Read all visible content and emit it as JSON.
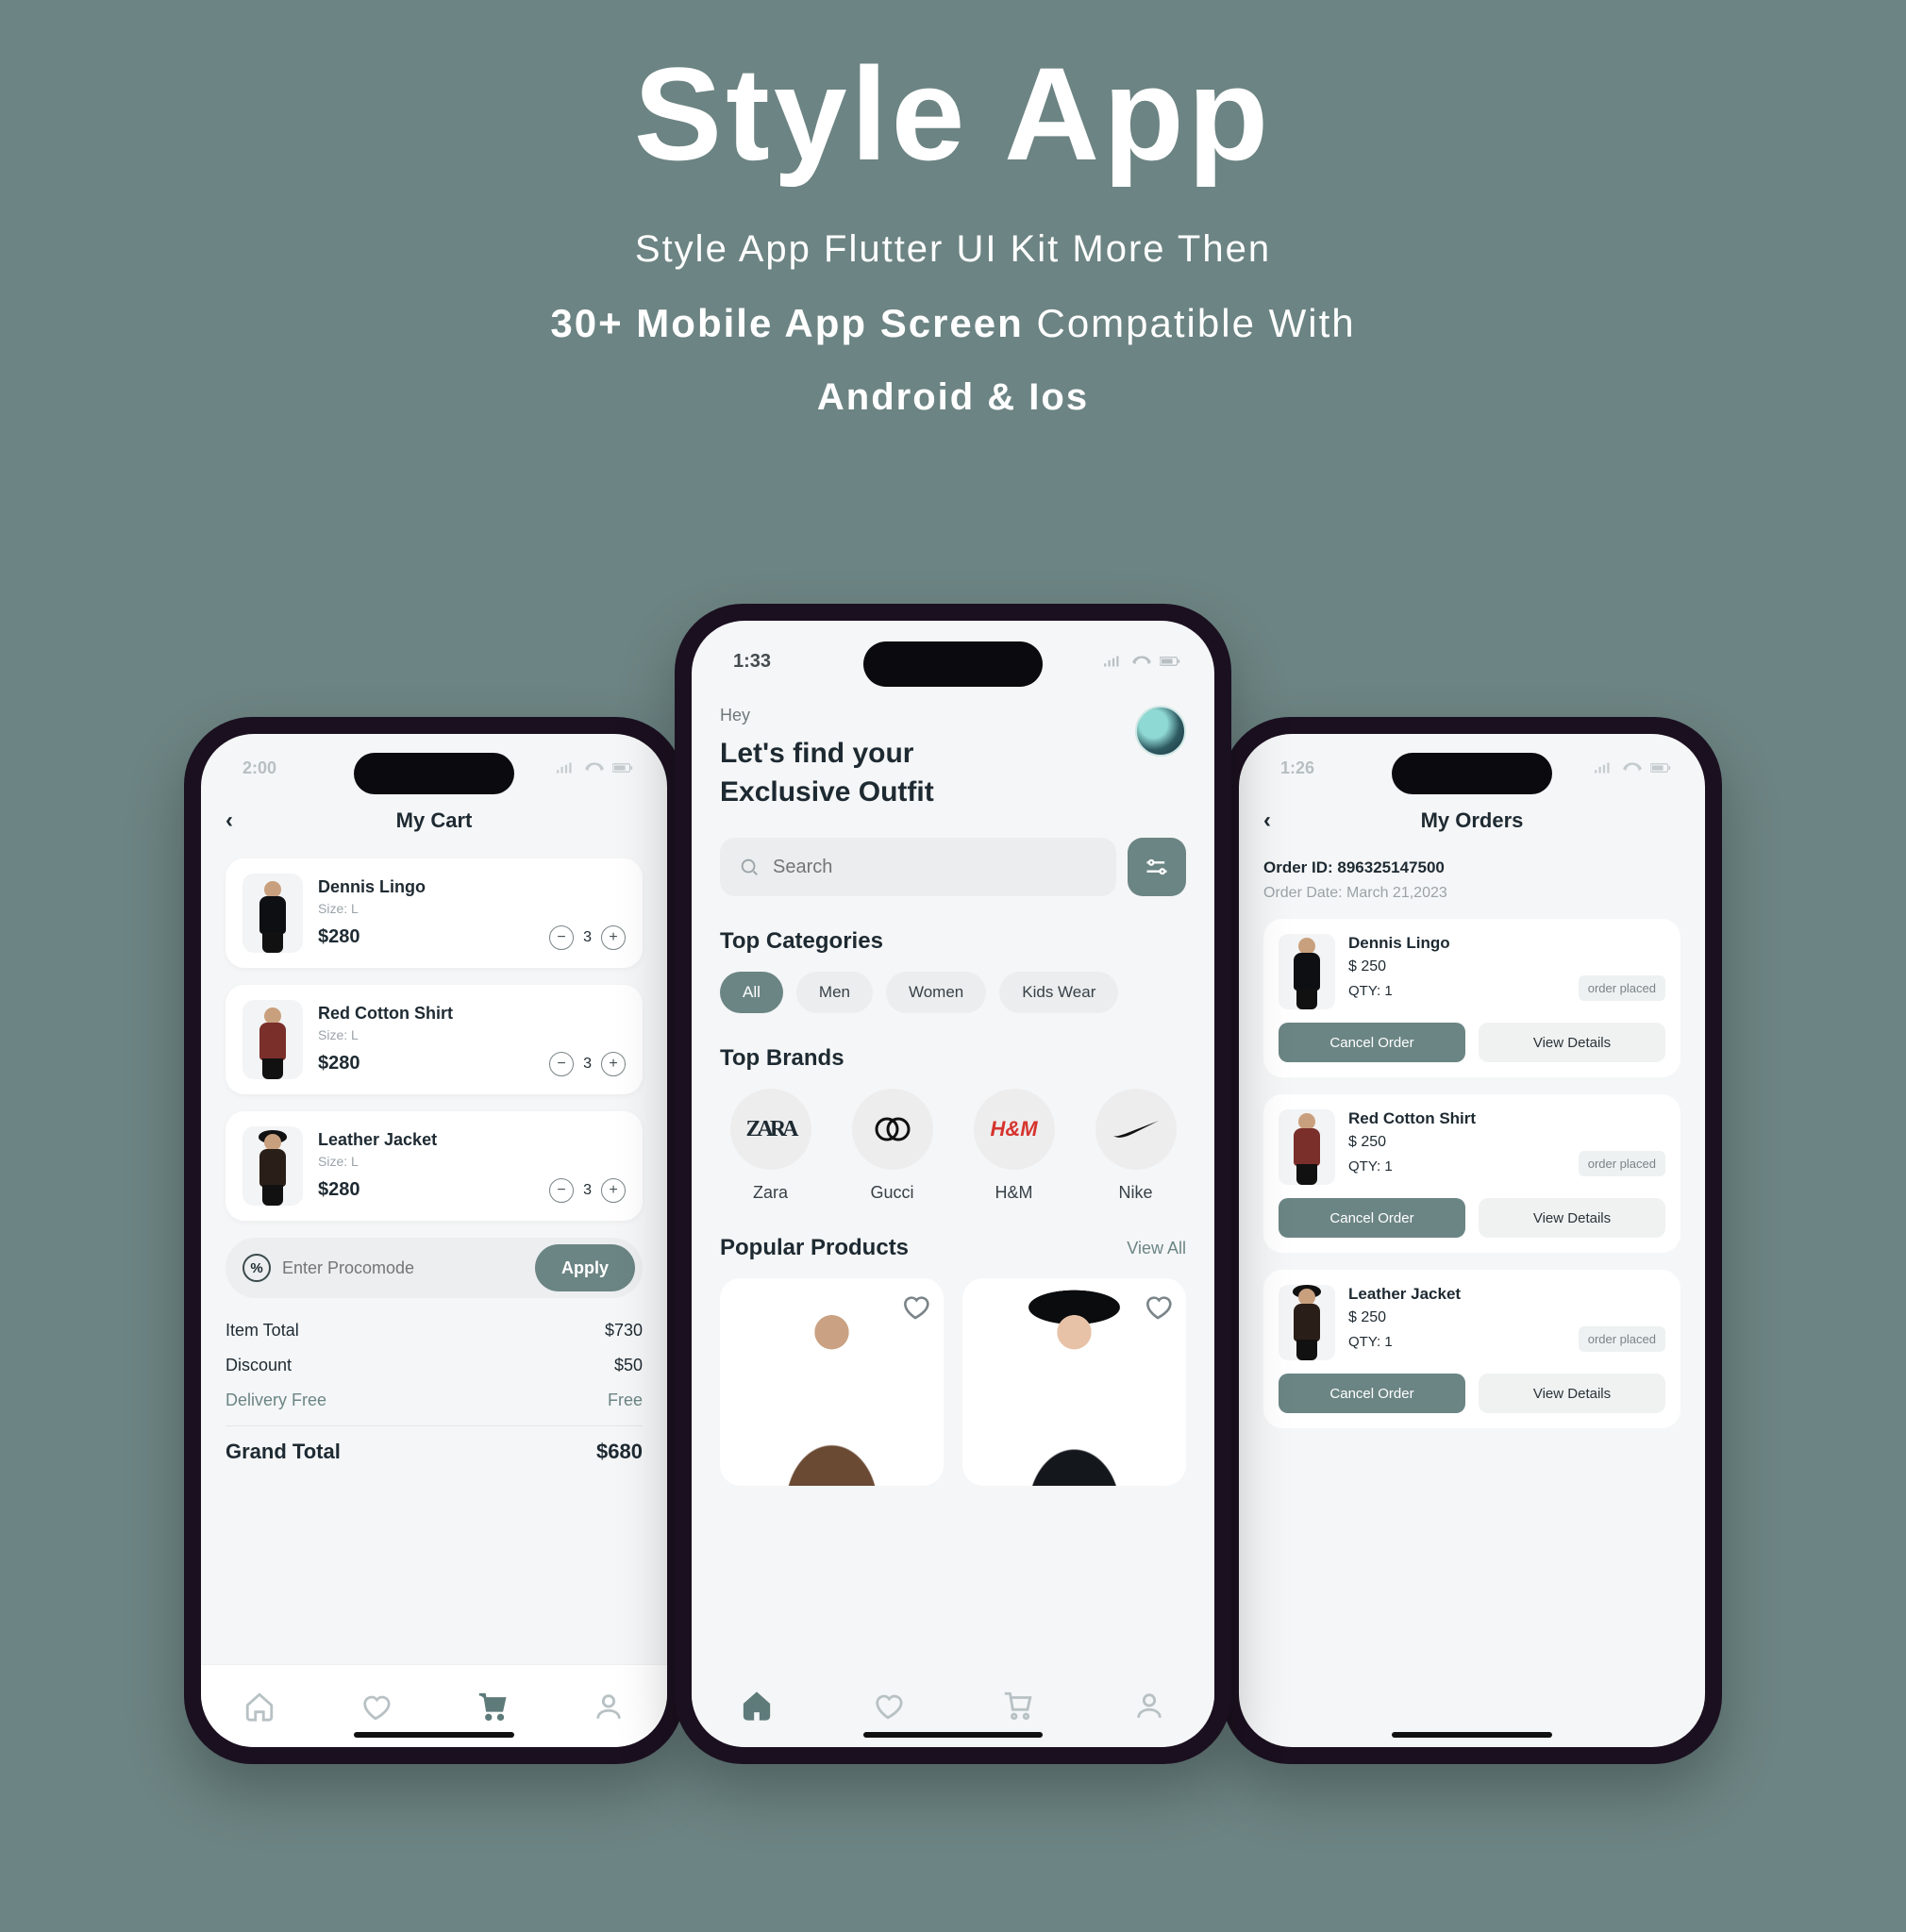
{
  "hero": {
    "title": "Style App",
    "line1": "Style App Flutter UI Kit More Then",
    "line2_bold": "30+ Mobile App Screen",
    "line2_rest": " Compatible With",
    "line3": "Android & Ios"
  },
  "status": {
    "left_time_dim": "2:00",
    "center_time": "1:33",
    "right_time_dim": "1:26"
  },
  "cart": {
    "title": "My Cart",
    "items": [
      {
        "name": "Dennis Lingo",
        "size": "Size: L",
        "price": "$280",
        "qty": "3"
      },
      {
        "name": "Red Cotton Shirt",
        "size": "Size: L",
        "price": "$280",
        "qty": "3"
      },
      {
        "name": "Leather Jacket",
        "size": "Size: L",
        "price": "$280",
        "qty": "3"
      }
    ],
    "promo_placeholder": "Enter Procomode",
    "apply": "Apply",
    "totals": {
      "item_total_label": "Item Total",
      "item_total": "$730",
      "discount_label": "Discount",
      "discount": "$50",
      "delivery_label": "Delivery Free",
      "delivery": "Free",
      "grand_label": "Grand Total",
      "grand": "$680"
    }
  },
  "home": {
    "greet": "Hey",
    "tag1": "Let's find your",
    "tag2": "Exclusive Outfit",
    "search_placeholder": "Search",
    "cats_title": "Top Categories",
    "cats": [
      "All",
      "Men",
      "Women",
      "Kids Wear"
    ],
    "brands_title": "Top Brands",
    "brands": [
      {
        "logo": "ZARA",
        "name": "Zara"
      },
      {
        "logo": "G",
        "name": "Gucci"
      },
      {
        "logo": "H&M",
        "name": "H&M"
      },
      {
        "logo": "✔",
        "name": "Nike"
      }
    ],
    "popular_title": "Popular Products",
    "view_all": "View All"
  },
  "orders": {
    "title": "My Orders",
    "order_id_label": "Order ID: 896325147500",
    "order_date": "Order Date: March 21,2023",
    "items": [
      {
        "name": "Dennis Lingo",
        "price": "$ 250",
        "qty": "QTY: 1",
        "status": "order placed"
      },
      {
        "name": "Red Cotton Shirt",
        "price": "$ 250",
        "qty": "QTY: 1",
        "status": "order placed"
      },
      {
        "name": "Leather Jacket",
        "price": "$ 250",
        "qty": "QTY: 1",
        "status": "order placed"
      }
    ],
    "cancel": "Cancel Order",
    "details": "View Details"
  }
}
